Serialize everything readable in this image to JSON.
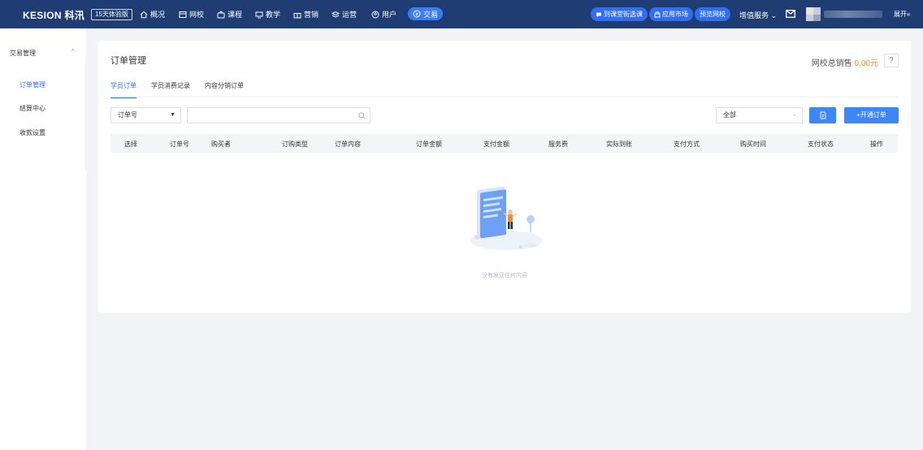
{
  "topbar": {
    "logo": "KESION 科汛",
    "trial_badge": "15天体验版",
    "nav": [
      {
        "label": "概况",
        "icon": "home-icon"
      },
      {
        "label": "网校",
        "icon": "school-icon"
      },
      {
        "label": "课程",
        "icon": "course-icon"
      },
      {
        "label": "教学",
        "icon": "teaching-icon"
      },
      {
        "label": "营销",
        "icon": "gift-icon"
      },
      {
        "label": "运营",
        "icon": "layers-icon"
      },
      {
        "label": "用户",
        "icon": "user-icon"
      },
      {
        "label": "交易",
        "icon": "coin-icon"
      }
    ],
    "pills": [
      {
        "label": "到课堂街选课",
        "icon": "chat-icon"
      },
      {
        "label": "应用市场",
        "icon": "store-icon"
      },
      {
        "label": "预览网校",
        "icon": ""
      }
    ],
    "value_services": "增值服务",
    "expand": "展开«"
  },
  "sidebar": {
    "group": "交易管理",
    "items": [
      {
        "label": "订单管理",
        "active": true
      },
      {
        "label": "结算中心",
        "active": false
      },
      {
        "label": "收款设置",
        "active": false
      }
    ]
  },
  "main": {
    "title": "订单管理",
    "sales_label": "网校总销售",
    "sales_amount": "0.00元",
    "help": "?",
    "tabs": [
      {
        "label": "学员订单",
        "active": true
      },
      {
        "label": "学员消费记录",
        "active": false
      },
      {
        "label": "内容分销订单",
        "active": false
      }
    ],
    "filter_field": "订单号",
    "search_placeholder": "",
    "status_filter": "全部",
    "open_order_button": "+开通订单",
    "columns": [
      "选择",
      "订单号",
      "购买者",
      "订购类型",
      "订单内容",
      "订单金额",
      "支付金额",
      "服务费",
      "实际到账",
      "支付方式",
      "购买时间",
      "支付状态",
      "操作"
    ],
    "empty_text": "没有发现任何内容"
  },
  "colors": {
    "topbar": "#1f3d73",
    "accent": "#2f6ff5",
    "sales_amount": "#f08a3c"
  }
}
